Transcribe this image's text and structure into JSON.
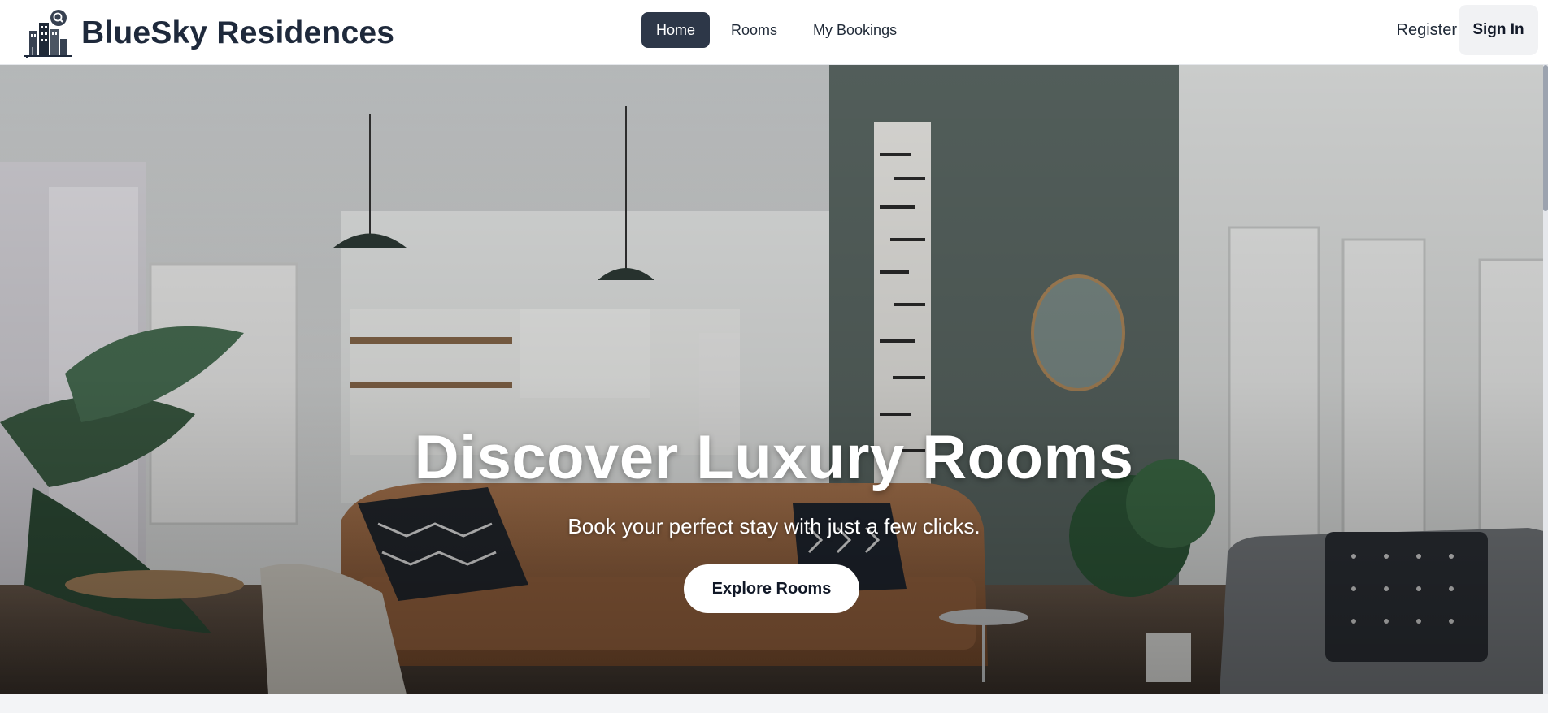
{
  "brand": {
    "name": "BlueSky Residences",
    "logo_icon": "building-search-icon"
  },
  "nav": {
    "links": [
      {
        "label": "Home",
        "active": true
      },
      {
        "label": "Rooms",
        "active": false
      },
      {
        "label": "My Bookings",
        "active": false
      }
    ]
  },
  "auth": {
    "register_label": "Register",
    "signin_label": "Sign In"
  },
  "hero": {
    "title": "Discover Luxury Rooms",
    "subtitle": "Book your perfect stay with just a few clicks.",
    "cta_label": "Explore Rooms",
    "image_icon": "living-room-photo"
  },
  "colors": {
    "nav_active_bg": "#2d3748",
    "brand_text": "#1e293b",
    "cta_bg": "#ffffff"
  }
}
